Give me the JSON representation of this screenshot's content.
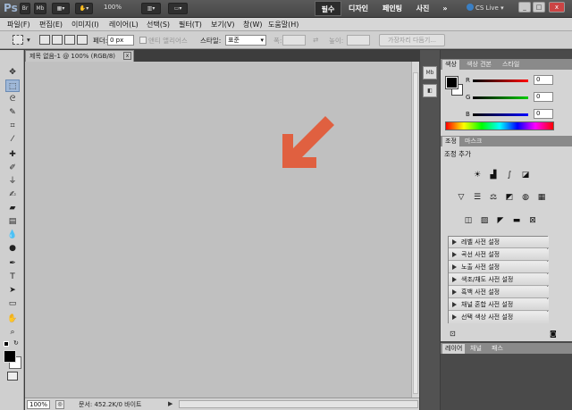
{
  "app": {
    "logo": "Ps",
    "zoom": "100%",
    "workspaces": [
      "필수",
      "디자인",
      "페인팅",
      "사진"
    ],
    "more": "»",
    "cslive": "CS Live",
    "window_buttons": [
      "_",
      "□",
      "x"
    ]
  },
  "menu": [
    "파일(F)",
    "편집(E)",
    "이미지(I)",
    "레이어(L)",
    "선택(S)",
    "필터(T)",
    "보기(V)",
    "창(W)",
    "도움말(H)"
  ],
  "options": {
    "feather_label": "페더:",
    "feather_value": "0 px",
    "antialias_label": "앤티 앨리어스",
    "style_label": "스타일:",
    "style_value": "표준",
    "width_label": "폭:",
    "height_label": "높이:",
    "refine_button": "가장자리 다듬기..."
  },
  "document": {
    "tab_title": "제목 없음-1 @ 100% (RGB/8)",
    "close": "x",
    "status_zoom": "100%",
    "status_doc": "문서: 452.2K/0 바이트",
    "canvas_color": "#c0c0c0",
    "arrow_color": "#e06040"
  },
  "tools": [
    "move",
    "marquee",
    "lasso",
    "quick-select",
    "crop",
    "eyedropper",
    "healing",
    "brush",
    "clone",
    "history-brush",
    "eraser",
    "gradient",
    "blur",
    "dodge",
    "pen",
    "type",
    "path-select",
    "shape",
    "hand",
    "zoom"
  ],
  "color_panel": {
    "tabs": [
      "색상",
      "색상 견본",
      "스타일"
    ],
    "r_label": "R",
    "g_label": "G",
    "b_label": "B",
    "r_value": "0",
    "g_value": "0",
    "b_value": "0"
  },
  "adjust_panel": {
    "tabs": [
      "조정",
      "마스크"
    ],
    "title": "조정 추가",
    "presets": [
      "레벨 사전 설정",
      "곡선 사전 설정",
      "노출 사전 설정",
      "색조/채도 사전 설정",
      "흑백 사전 설정",
      "채널 혼합 사전 설정",
      "선택 색상 사전 설정"
    ]
  },
  "layers_panel": {
    "tabs": [
      "레이어",
      "채널",
      "패스"
    ]
  }
}
